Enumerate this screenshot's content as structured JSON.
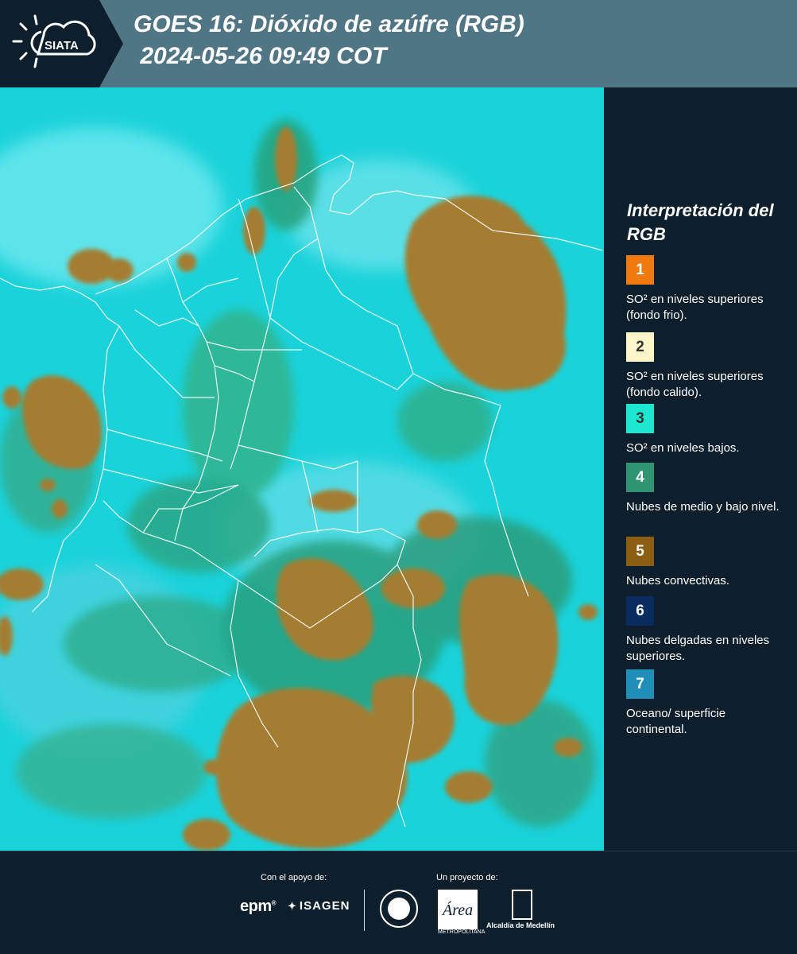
{
  "header": {
    "logo_text": "SIATA",
    "title_line1": "GOES 16: Dióxido de azúfre (RGB)",
    "title_line2": " 2024-05-26 09:49 COT",
    "background_color": "#507585"
  },
  "map": {
    "description_colors": {
      "surface": "#1ad6dc",
      "low_level": "#24a88c",
      "convective": "#9c7a2c"
    },
    "borders_color": "#ffffff"
  },
  "legend": {
    "title": "Interpretación del RGB",
    "items": [
      {
        "number": "1",
        "color": "#f07a10",
        "text_color": "#ffffff",
        "label": "SO² en niveles superiores (fondo frio)."
      },
      {
        "number": "2",
        "color": "#fdf6c8",
        "text_color": "#333333",
        "label": "SO² en niveles superiores (fondo calido)."
      },
      {
        "number": "3",
        "color": "#1de8cf",
        "text_color": "#333333",
        "label": "SO² en niveles bajos."
      },
      {
        "number": "4",
        "color": "#2e9472",
        "text_color": "#ffffff",
        "label": "Nubes de medio y bajo nivel."
      },
      {
        "number": "5",
        "color": "#8c5e12",
        "text_color": "#ffffff",
        "label": "Nubes convectivas."
      },
      {
        "number": "6",
        "color": "#0a2b60",
        "text_color": "#ffffff",
        "label": "Nubes delgadas en niveles superiores."
      },
      {
        "number": "7",
        "color": "#1f8fb8",
        "text_color": "#ffffff",
        "label": "Oceano/ superficie continental."
      }
    ]
  },
  "footer": {
    "support_label": "Con el apoyo de:",
    "project_label": "Un proyecto de:",
    "sponsor_1": "epm",
    "sponsor_2": "ISAGEN",
    "area_text": "METROPOLITANA",
    "alcaldia_text": "Alcaldía de Medellín"
  }
}
